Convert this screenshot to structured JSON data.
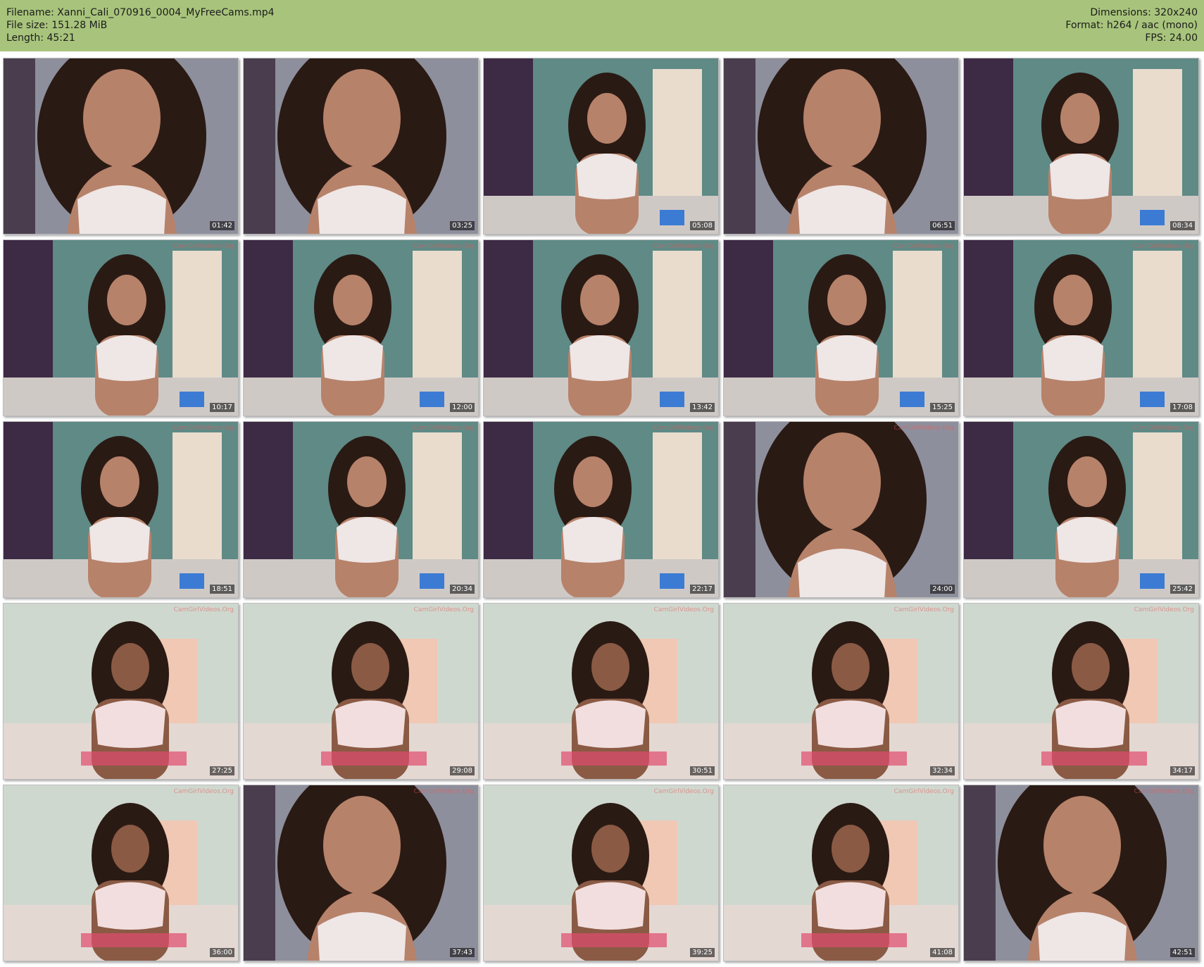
{
  "header": {
    "filename": "Filename: Xanni_Cali_070916_0004_MyFreeCams.mp4",
    "filesize": "File size: 151.28 MiB",
    "length": "Length: 45:21",
    "dimensions": "Dimensions: 320x240",
    "format": "Format: h264 / aac (mono)",
    "fps": "FPS: 24.00"
  },
  "watermark": "CamGirlVideos.Org",
  "thumbnails": [
    {
      "time": "01:42",
      "scene": "closeup"
    },
    {
      "time": "03:25",
      "scene": "closeup"
    },
    {
      "time": "05:08",
      "scene": "room"
    },
    {
      "time": "06:51",
      "scene": "closeup"
    },
    {
      "time": "08:34",
      "scene": "room"
    },
    {
      "time": "10:17",
      "scene": "room"
    },
    {
      "time": "12:00",
      "scene": "room"
    },
    {
      "time": "13:42",
      "scene": "room"
    },
    {
      "time": "15:25",
      "scene": "room"
    },
    {
      "time": "17:08",
      "scene": "room"
    },
    {
      "time": "18:51",
      "scene": "room"
    },
    {
      "time": "20:34",
      "scene": "room"
    },
    {
      "time": "22:17",
      "scene": "room"
    },
    {
      "time": "24:00",
      "scene": "closeup"
    },
    {
      "time": "25:42",
      "scene": "room"
    },
    {
      "time": "27:25",
      "scene": "bedroom"
    },
    {
      "time": "29:08",
      "scene": "bedroom"
    },
    {
      "time": "30:51",
      "scene": "bedroom"
    },
    {
      "time": "32:34",
      "scene": "bedroom"
    },
    {
      "time": "34:17",
      "scene": "bedroom"
    },
    {
      "time": "36:00",
      "scene": "bedroom"
    },
    {
      "time": "37:43",
      "scene": "closeup"
    },
    {
      "time": "39:25",
      "scene": "bedroom"
    },
    {
      "time": "41:08",
      "scene": "bedroom"
    },
    {
      "time": "42:51",
      "scene": "closeup"
    }
  ],
  "colors": {
    "header_bg": "#a8c47c",
    "wall_teal": "#5f8a86",
    "door_cream": "#e9dccd",
    "skin": "#b7826a",
    "hair": "#2a1a14",
    "top_white": "#efe6e6"
  }
}
